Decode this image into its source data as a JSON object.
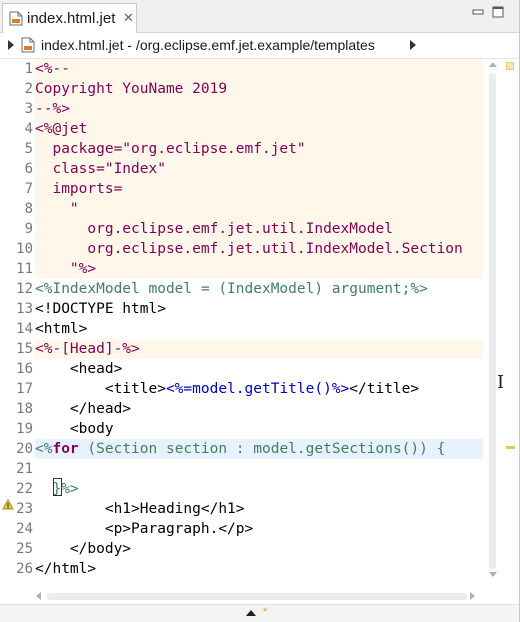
{
  "tab": {
    "label": "index.html.jet",
    "close_glyph": "✕",
    "icon": "jet-file-icon"
  },
  "window_buttons": [
    "minimize-icon",
    "maximize-icon"
  ],
  "breadcrumb": {
    "text": "index.html.jet - /org.eclipse.emf.jet.example/templates"
  },
  "editor": {
    "caret_line": 22,
    "warning_line": 20,
    "lines": [
      {
        "n": "1",
        "bg": true,
        "tokens": [
          {
            "t": "<%--",
            "c": "dir"
          }
        ]
      },
      {
        "n": "2",
        "bg": true,
        "tokens": [
          {
            "t": "Copyright YouName 2019",
            "c": "body"
          }
        ]
      },
      {
        "n": "3",
        "bg": true,
        "tokens": [
          {
            "t": "--%>",
            "c": "dir"
          }
        ]
      },
      {
        "n": "4",
        "bg": true,
        "tokens": [
          {
            "t": "<%@jet",
            "c": "dir"
          }
        ]
      },
      {
        "n": "5",
        "bg": true,
        "tokens": [
          {
            "t": "  package=\"org.eclipse.emf.jet\"",
            "c": "body"
          }
        ]
      },
      {
        "n": "6",
        "bg": true,
        "tokens": [
          {
            "t": "  class=\"Index\"",
            "c": "body"
          }
        ]
      },
      {
        "n": "7",
        "bg": true,
        "tokens": [
          {
            "t": "  imports=",
            "c": "body"
          }
        ]
      },
      {
        "n": "8",
        "bg": true,
        "tokens": [
          {
            "t": "    \"",
            "c": "body"
          }
        ]
      },
      {
        "n": "9",
        "bg": true,
        "tokens": [
          {
            "t": "      org.eclipse.emf.jet.util.IndexModel",
            "c": "body"
          }
        ]
      },
      {
        "n": "10",
        "bg": true,
        "tokens": [
          {
            "t": "      org.eclipse.emf.jet.util.IndexModel.Section",
            "c": "body"
          }
        ]
      },
      {
        "n": "11",
        "bg": true,
        "tokens": [
          {
            "t": "    \"%>",
            "c": "body"
          }
        ]
      },
      {
        "n": "12",
        "bg": false,
        "tokens": [
          {
            "t": "<%IndexModel model = (IndexModel) argument;%>",
            "c": "cmt"
          }
        ]
      },
      {
        "n": "13",
        "bg": false,
        "tokens": [
          {
            "t": "<!DOCTYPE html>",
            "c": "txt"
          }
        ]
      },
      {
        "n": "14",
        "bg": false,
        "tokens": [
          {
            "t": "<html>",
            "c": "txt"
          }
        ]
      },
      {
        "n": "15",
        "bg": true,
        "tokens": [
          {
            "t": "<%-[Head]-%>",
            "c": "dir"
          }
        ]
      },
      {
        "n": "16",
        "bg": false,
        "tokens": [
          {
            "t": "    <head>",
            "c": "txt"
          }
        ]
      },
      {
        "n": "17",
        "bg": false,
        "tokens": [
          {
            "t": "        <title>",
            "c": "txt"
          },
          {
            "t": "<%=model.getTitle()%>",
            "c": "exp"
          },
          {
            "t": "</title>",
            "c": "txt"
          }
        ]
      },
      {
        "n": "18",
        "bg": false,
        "tokens": [
          {
            "t": "    </head>",
            "c": "txt"
          }
        ]
      },
      {
        "n": "19",
        "bg": false,
        "tokens": [
          {
            "t": "    <body",
            "c": "txt"
          }
        ]
      },
      {
        "n": "20",
        "bg": false,
        "hl": true,
        "tokens": [
          {
            "t": "<%",
            "c": "cmt"
          },
          {
            "t": "for",
            "c": "kw"
          },
          {
            "t": " (Section section : model.getSections()) {",
            "c": "cmt"
          }
        ]
      },
      {
        "n": "21",
        "bg": false,
        "tokens": [
          {
            "t": " ",
            "c": "txt"
          }
        ]
      },
      {
        "n": "22",
        "bg": false,
        "tokens": [
          {
            "t": "  }%>",
            "c": "cmt"
          }
        ]
      },
      {
        "n": "23",
        "bg": false,
        "tokens": [
          {
            "t": "        <h1>Heading</h1>",
            "c": "txt"
          }
        ]
      },
      {
        "n": "24",
        "bg": false,
        "tokens": [
          {
            "t": "        <p>Paragraph.</p>",
            "c": "txt"
          }
        ]
      },
      {
        "n": "25",
        "bg": false,
        "tokens": [
          {
            "t": "    </body>",
            "c": "txt"
          }
        ]
      },
      {
        "n": "26",
        "bg": false,
        "tokens": [
          {
            "t": "</html>",
            "c": "txt"
          }
        ]
      }
    ]
  },
  "bottom": {
    "dirty_marker": "*"
  },
  "colors": {
    "directive": "#7f0055",
    "keyword": "#7f0055",
    "expression": "#0000c0",
    "scriptlet": "#3f7f5f",
    "template_bg": "#fff8ea",
    "current_line": "#e8f2fe"
  }
}
